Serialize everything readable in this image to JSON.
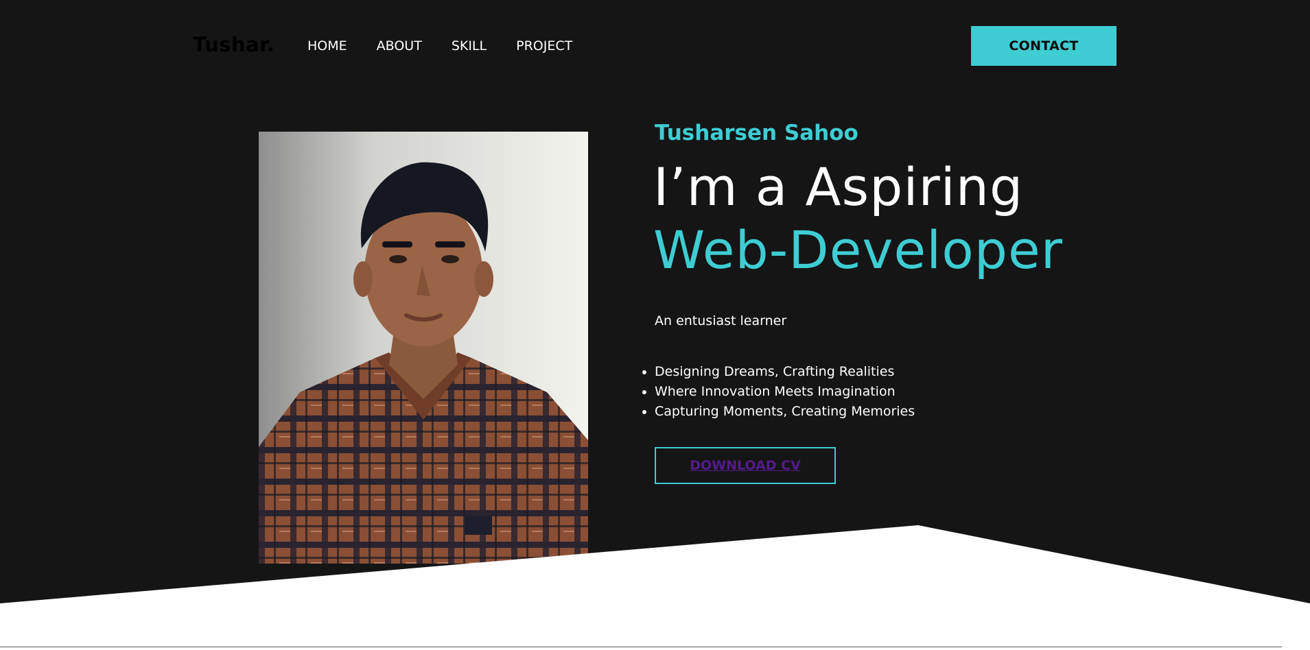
{
  "nav": {
    "logo": "Tushar.",
    "links": [
      "HOME",
      "ABOUT",
      "SKILL",
      "PROJECT"
    ],
    "contact_label": "CONTACT"
  },
  "hero": {
    "name": "Tusharsen Sahoo",
    "headline_line1": "I’m a Aspiring",
    "headline_line2": "Web-Developer",
    "tagline": "An entusiast learner",
    "bullets": [
      "Designing Dreams, Crafting Realities",
      "Where Innovation Meets Imagination",
      "Capturing Moments, Creating Memories"
    ],
    "download_label": "DOWNLOAD CV"
  },
  "colors": {
    "background": "#151516",
    "accent": "#3ecdd3",
    "text": "#ffffff",
    "link_visited": "#551a8b"
  },
  "icons": {
    "photo": "profile-photo"
  }
}
